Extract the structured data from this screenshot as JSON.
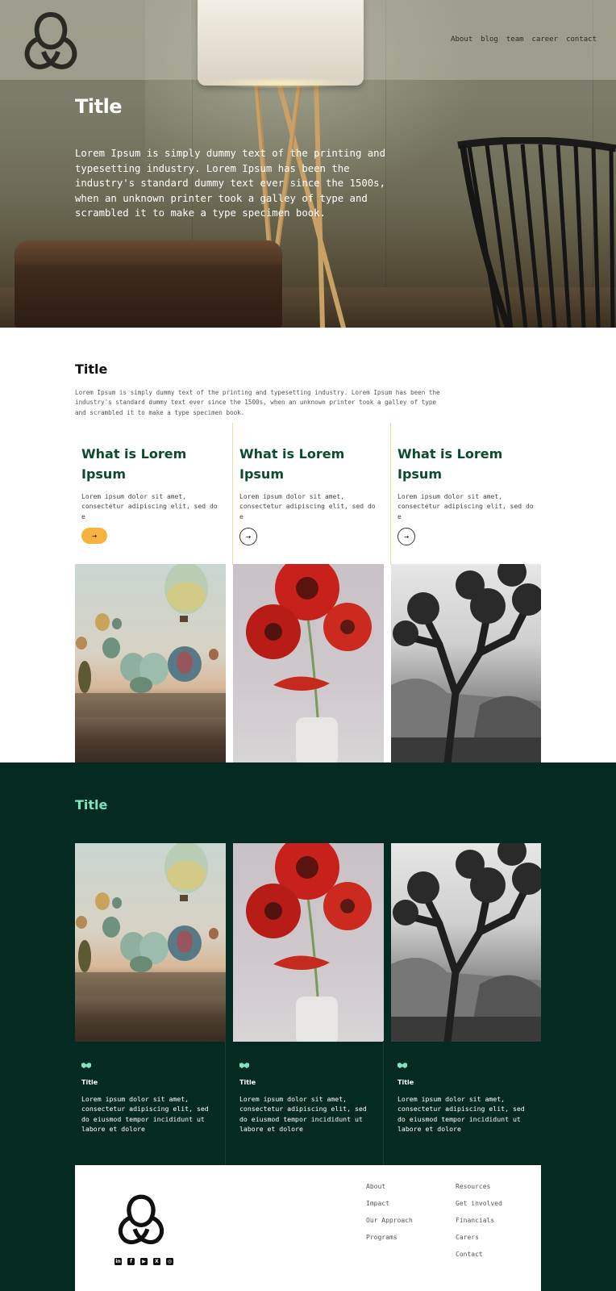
{
  "nav": {
    "links": [
      "About",
      "blog",
      "team",
      "career",
      "contact"
    ]
  },
  "hero": {
    "title": "Title",
    "text": "Lorem Ipsum is simply dummy text of the printing and typesetting industry. Lorem Ipsum has been the industry's standard dummy text ever since the 1500s, when an unknown printer took a galley of type and scrambled it to make a type specimen book."
  },
  "intro": {
    "title": "Title",
    "text": "Lorem Ipsum is simply dummy text of the printing and typesetting industry. Lorem Ipsum has been the industry's standard dummy text ever since the 1500s, when an unknown printer took a galley of type and scrambled it to make a type specimen book."
  },
  "features": [
    {
      "title": "What is Lorem Ipsum",
      "text": "Lorem ipsum dolor sit amet, consectetur adipiscing elit, sed do e",
      "button": "→"
    },
    {
      "title": "What is Lorem Ipsum",
      "text": "Lorem ipsum dolor sit amet, consectetur adipiscing elit, sed do e",
      "button": "→"
    },
    {
      "title": "What is Lorem Ipsum",
      "text": "Lorem ipsum dolor sit amet, consectetur adipiscing elit, sed do e",
      "button": "→"
    }
  ],
  "gallery": {
    "title": "Title",
    "cards": [
      {
        "icon": "handshake-icon",
        "title": "Title",
        "text": "Lorem ipsum dolor sit amet, consectetur adipiscing elit, sed do eiusmod tempor incididunt ut labore et dolore"
      },
      {
        "icon": "handshake-icon",
        "title": "Title",
        "text": "Lorem ipsum dolor sit amet, consectetur adipiscing elit, sed do eiusmod tempor incididunt ut labore et dolore"
      },
      {
        "icon": "handshake-icon",
        "title": "Title",
        "text": "Lorem ipsum dolor sit amet, consectetur adipiscing elit, sed do eiusmod tempor incididunt ut labore et dolore"
      }
    ]
  },
  "footer": {
    "col1": [
      "About",
      "Impact",
      "Our Approach",
      "Programs"
    ],
    "col2": [
      "Resources",
      "Get involved",
      "Financials",
      "Carers",
      "Contact"
    ],
    "social": [
      {
        "icon": "linkedin-icon",
        "glyph": "in"
      },
      {
        "icon": "facebook-icon",
        "glyph": "f"
      },
      {
        "icon": "youtube-icon",
        "glyph": "▶"
      },
      {
        "icon": "x-icon",
        "glyph": "X"
      },
      {
        "icon": "instagram-icon",
        "glyph": "◎"
      }
    ]
  },
  "colors": {
    "brand_green": "#042a21",
    "heading_green": "#0d4a2e",
    "mint": "#7ee2bd",
    "accent_yellow": "#f6b23e"
  }
}
